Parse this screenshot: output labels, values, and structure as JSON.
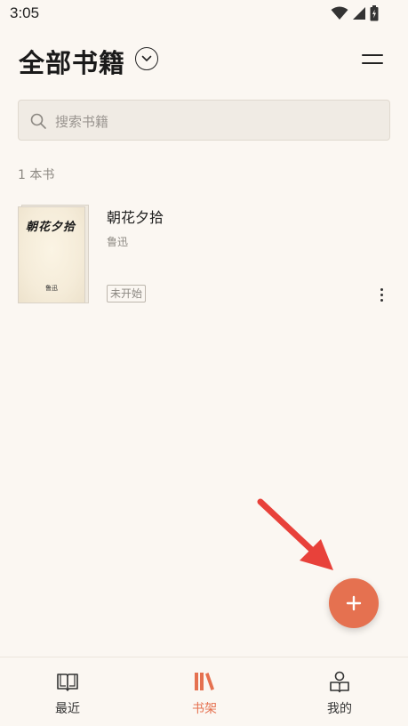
{
  "status_bar": {
    "time": "3:05"
  },
  "header": {
    "title": "全部书籍"
  },
  "search": {
    "placeholder": "搜索书籍"
  },
  "library": {
    "count_label": "1 本书",
    "books": [
      {
        "title": "朝花夕拾",
        "author": "鲁迅",
        "status": "未开始",
        "cover_title": "朝花夕拾",
        "cover_author": "鲁迅"
      }
    ]
  },
  "bottom_nav": {
    "items": [
      {
        "label": "最近",
        "icon": "open-book-icon",
        "active": false
      },
      {
        "label": "书架",
        "icon": "bookshelf-icon",
        "active": true
      },
      {
        "label": "我的",
        "icon": "profile-reading-icon",
        "active": false
      }
    ]
  },
  "colors": {
    "accent": "#e57150",
    "background": "#fbf7f2",
    "annotation_arrow": "#e8413a"
  }
}
